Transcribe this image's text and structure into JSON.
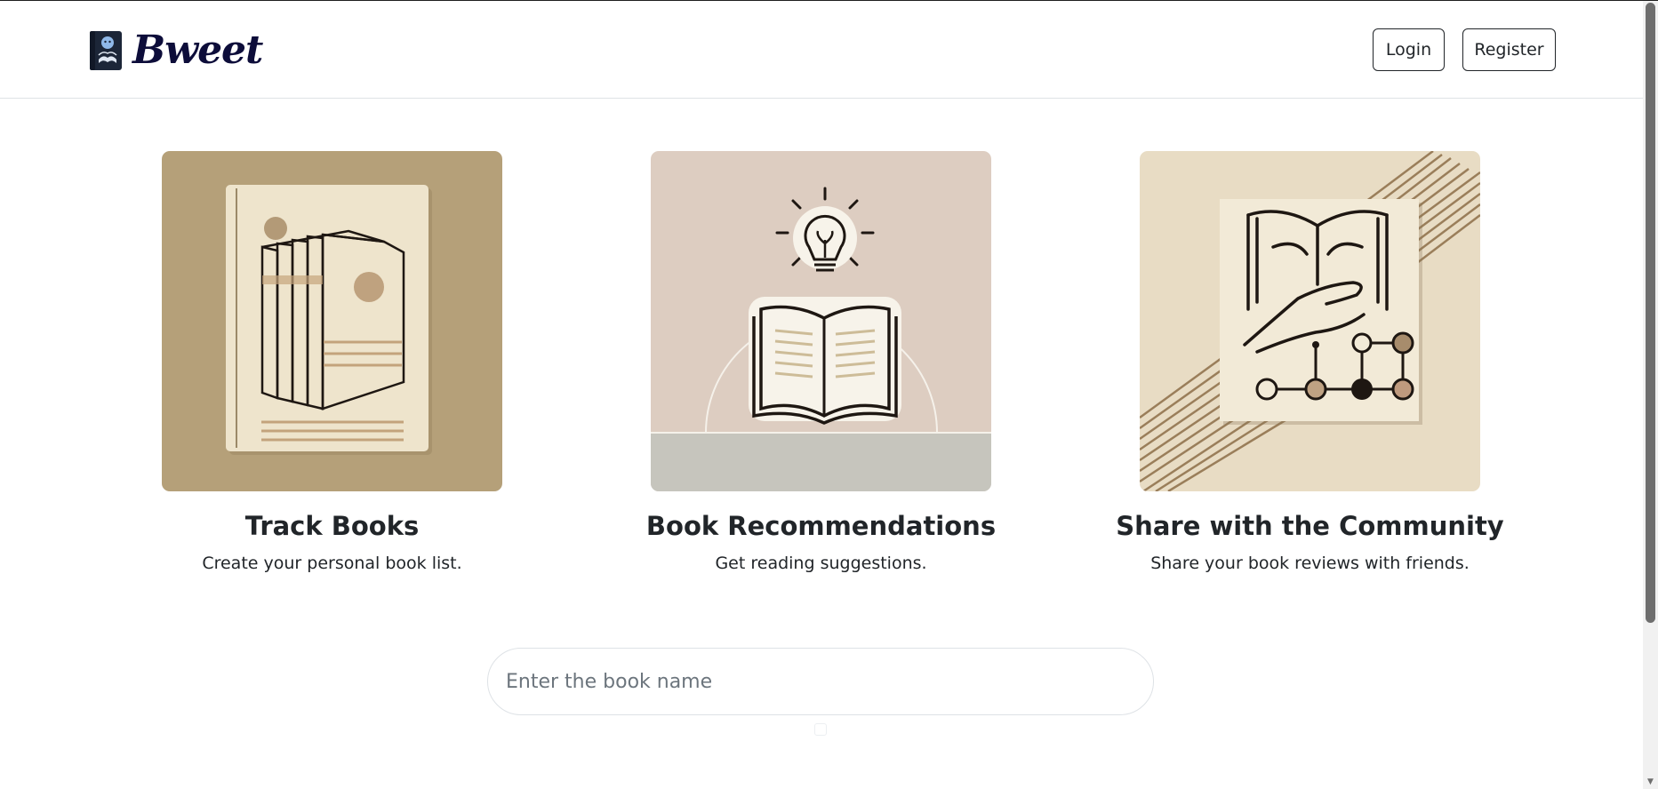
{
  "header": {
    "brand": "Bweet",
    "login_label": "Login",
    "register_label": "Register"
  },
  "features": [
    {
      "title": "Track Books",
      "description": "Create your personal book list.",
      "icon": "books-illustration"
    },
    {
      "title": "Book Recommendations",
      "description": "Get reading suggestions.",
      "icon": "lightbulb-book-illustration"
    },
    {
      "title": "Share with the Community",
      "description": "Share your book reviews with friends.",
      "icon": "hand-book-network-illustration"
    }
  ],
  "search": {
    "placeholder": "Enter the book name",
    "value": ""
  },
  "colors": {
    "brand_text": "#0d0d3a",
    "tan": "#b5a079",
    "cream": "#efe6d2",
    "ink": "#1e1712"
  }
}
